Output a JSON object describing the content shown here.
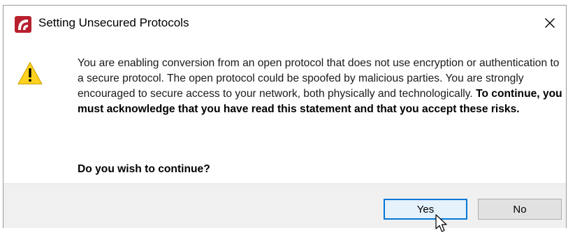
{
  "dialog": {
    "title": "Setting Unsecured Protocols",
    "app_icon": "brand-logo-icon",
    "close_icon": "close-icon",
    "close_glyph": "✕",
    "warning_icon": "warning-icon",
    "message_normal": "You are enabling conversion from an open protocol that does not use encryption or authentication to a secure protocol. The open protocol could be spoofed by malicious parties. You are strongly encouraged to secure access to your network, both physically and technologically. ",
    "message_bold": "To continue, you must acknowledge that you have read this statement and that you accept these risks.",
    "question": "Do you wish to continue?",
    "buttons": {
      "yes": "Yes",
      "no": "No"
    }
  },
  "colors": {
    "brand": "#b8202e",
    "warning": "#ffd21f",
    "focus": "#0078d7",
    "footer_bg": "#f0f0f0"
  }
}
